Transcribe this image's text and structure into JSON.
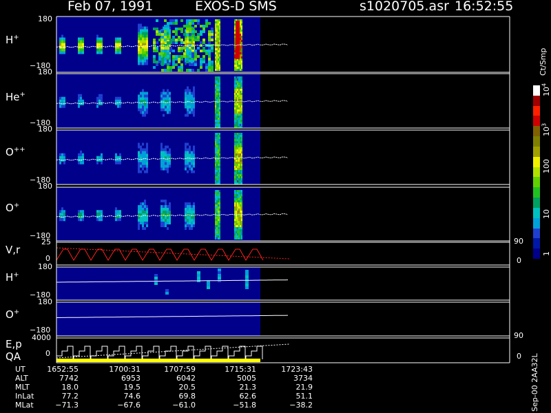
{
  "header": {
    "date": "Feb 07, 1991",
    "mission": "EXOS-D SMS",
    "filename": "s1020705.asr",
    "time": "16:52:55"
  },
  "panels": [
    {
      "label": "H",
      "charge": "+",
      "ytop": "180",
      "ybot": "−180",
      "intensity": 1.0
    },
    {
      "label": "He",
      "charge": "+",
      "ytop": "180",
      "ybot": "−180",
      "intensity": 0.6
    },
    {
      "label": "O",
      "charge": "++",
      "ytop": "180",
      "ybot": "−180",
      "intensity": 0.6
    },
    {
      "label": "O",
      "charge": "+",
      "ytop": "180",
      "ybot": "−180",
      "intensity": 0.8
    }
  ],
  "line_panels": [
    {
      "label": "V,r",
      "ytop": "25",
      "ybot": "0",
      "rtop": "90",
      "rbot": "0"
    },
    {
      "label": "E,p",
      "label2": "QA",
      "ytop": "4000",
      "ybot": "0",
      "rtop": "90",
      "rbot": "0"
    }
  ],
  "low_panels": [
    {
      "label": "H",
      "charge": "+",
      "ytop": "180",
      "ybot": "−180"
    },
    {
      "label": "O",
      "charge": "+",
      "ytop": "180",
      "ybot": "−180"
    }
  ],
  "colorbar": {
    "unit": "Ct/Smp",
    "labels": [
      {
        "text": "1",
        "sup": ""
      },
      {
        "text": "10",
        "sup": ""
      },
      {
        "text": "100",
        "sup": ""
      },
      {
        "text": "10",
        "sup": "3"
      },
      {
        "text": "10",
        "sup": "4"
      }
    ],
    "colors": [
      "#00008b",
      "#0018a8",
      "#1f3fd0",
      "#00a0d8",
      "#00c0c0",
      "#00a060",
      "#20c020",
      "#60d000",
      "#b0e000",
      "#f0f000",
      "#a0a000",
      "#808000",
      "#806000",
      "#d00000",
      "#ff2000",
      "#a00000",
      "#ffffff"
    ]
  },
  "time_table": {
    "rows": [
      {
        "name": "UT",
        "values": [
          "1652:55",
          "1700:31",
          "1707:59",
          "1715:31",
          "1723:43"
        ]
      },
      {
        "name": "ALT",
        "values": [
          "7742",
          "6953",
          "6042",
          "5005",
          "3734"
        ]
      },
      {
        "name": "MLT",
        "values": [
          "18.0",
          "19.5",
          "20.5",
          "21.3",
          "21.9"
        ]
      },
      {
        "name": "InLat",
        "values": [
          "77.2",
          "74.6",
          "69.8",
          "62.6",
          "51.1"
        ]
      },
      {
        "name": "MLat",
        "values": [
          "−71.3",
          "−67.6",
          "−61.0",
          "−51.8",
          "−38.2"
        ]
      }
    ]
  },
  "footer": {
    "stamp": "Sep-00  2AA32L"
  },
  "chart_data": {
    "type": "heatmap",
    "title": "Feb 07, 1991   EXOS-D SMS",
    "xlabel": "UT",
    "x_ticks": [
      "1652:55",
      "1700:31",
      "1707:59",
      "1715:31",
      "1723:43"
    ],
    "series": [
      {
        "name": "H+",
        "ylim": [
          -180,
          180
        ]
      },
      {
        "name": "He+",
        "ylim": [
          -180,
          180
        ]
      },
      {
        "name": "O++",
        "ylim": [
          -180,
          180
        ]
      },
      {
        "name": "O+",
        "ylim": [
          -180,
          180
        ]
      }
    ],
    "colorscale": {
      "unit": "Ct/Smp",
      "range": [
        1,
        10000
      ],
      "log": true
    }
  }
}
